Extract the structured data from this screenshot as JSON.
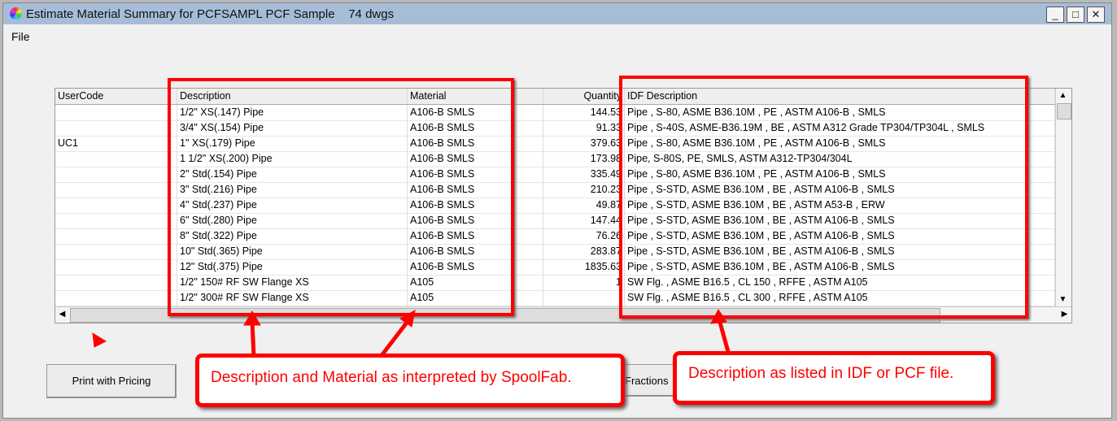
{
  "window": {
    "title": "Estimate Material Summary for PCFSAMPL PCF Sample    74 dwgs",
    "minimize": "_",
    "maximize": "□",
    "close": "✕"
  },
  "menu": {
    "file": "File"
  },
  "table": {
    "headers": [
      "UserCode",
      "Description",
      "Material",
      "Quantity",
      "IDF Description"
    ],
    "rows": [
      [
        "",
        "1/2\" XS(.147) Pipe",
        "A106-B SMLS",
        "144.53",
        "Pipe , S-80, ASME B36.10M , PE , ASTM A106-B , SMLS"
      ],
      [
        "",
        "3/4\" XS(.154) Pipe",
        "A106-B SMLS",
        "91.33",
        "Pipe , S-40S, ASME-B36.19M , BE , ASTM A312 Grade TP304/TP304L , SMLS"
      ],
      [
        "UC1",
        "1\" XS(.179) Pipe",
        "A106-B SMLS",
        "379.63",
        "Pipe , S-80, ASME B36.10M , PE , ASTM A106-B , SMLS"
      ],
      [
        "",
        "1 1/2\" XS(.200) Pipe",
        "A106-B SMLS",
        "173.98",
        "Pipe, S-80S, PE, SMLS, ASTM A312-TP304/304L"
      ],
      [
        "",
        "2\" Std(.154) Pipe",
        "A106-B SMLS",
        "335.49",
        "Pipe , S-80, ASME B36.10M , PE , ASTM A106-B , SMLS"
      ],
      [
        "",
        "3\" Std(.216) Pipe",
        "A106-B SMLS",
        "210.23",
        "Pipe , S-STD, ASME B36.10M , BE , ASTM A106-B , SMLS"
      ],
      [
        "",
        "4\" Std(.237) Pipe",
        "A106-B SMLS",
        "49.87",
        "Pipe , S-STD, ASME B36.10M , BE , ASTM A53-B , ERW"
      ],
      [
        "",
        "6\" Std(.280) Pipe",
        "A106-B SMLS",
        "147.44",
        "Pipe , S-STD, ASME B36.10M , BE , ASTM A106-B , SMLS"
      ],
      [
        "",
        "8\" Std(.322) Pipe",
        "A106-B SMLS",
        "76.26",
        "Pipe , S-STD, ASME B36.10M , BE , ASTM A106-B , SMLS"
      ],
      [
        "",
        "10\" Std(.365) Pipe",
        "A106-B SMLS",
        "283.87",
        "Pipe , S-STD, ASME B36.10M , BE , ASTM A106-B , SMLS"
      ],
      [
        "",
        "12\" Std(.375) Pipe",
        "A106-B SMLS",
        "1835.63",
        "Pipe , S-STD, ASME B36.10M , BE , ASTM A106-B , SMLS"
      ],
      [
        "",
        "1/2\" 150# RF SW Flange XS",
        "A105",
        "1",
        "SW Flg. , ASME B16.5 , CL 150 , RFFE , ASTM A105"
      ],
      [
        "",
        "1/2\" 300# RF SW Flange XS",
        "A105",
        "",
        "SW Flg. , ASME B16.5 , CL 300 , RFFE , ASTM A105"
      ]
    ]
  },
  "buttons": {
    "print_pricing": "Print with Pricing",
    "fractions": "Fractions"
  },
  "callouts": {
    "left": "Description and Material as interpreted by SpoolFab.",
    "right": "Description as listed in IDF or PCF file."
  },
  "colors": {
    "annotation": "#ff0000",
    "titlebar": "#a6bdd8"
  }
}
